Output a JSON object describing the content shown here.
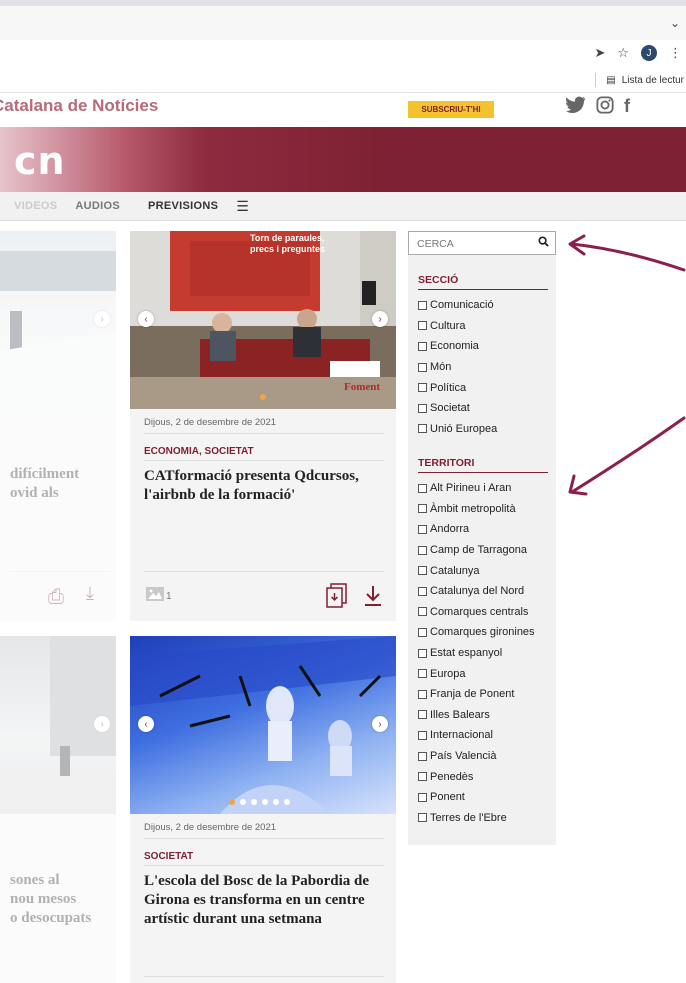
{
  "browser": {
    "avatar_letter": "J",
    "bookmark_label": "Lista de lectur"
  },
  "site": {
    "brand": "Catalana de Notícies",
    "subscribe": "SUBSCRIU-T'HI",
    "logo": "cn",
    "nav": [
      "VIDEOS",
      "AUDIOS",
      "PREVISIONS"
    ],
    "menu_icon": "☰"
  },
  "cards": [
    {
      "date": "Dijous, 2 de desembre de 2021",
      "categories": "ECONOMIA, SOCIETAT",
      "title": "CATformació presenta Qdcursos, l'airbnb de la formació'",
      "photo_count": "1",
      "slide_text": "Torn de paraules, precs i preguntes",
      "slide_brand": "Foment"
    },
    {
      "date": "Dijous, 2 de desembre de 2021",
      "categories": "SOCIETAT",
      "title": "L'escola del Bosc de la Pabordia de Girona es transforma en un centre artístic durant una setmana"
    }
  ],
  "left_cards": [
    {
      "title_lines": [
        "difícilment",
        "ovid als"
      ]
    },
    {
      "title_lines": [
        "sones al",
        "nou mesos",
        "o desocupats"
      ]
    }
  ],
  "sidebar": {
    "search_placeholder": "CERCA",
    "seccio_title": "SECCIÓ",
    "seccio_items": [
      "Comunicació",
      "Cultura",
      "Economia",
      "Món",
      "Política",
      "Societat",
      "Unió Europea"
    ],
    "territori_title": "TERRITORI",
    "territori_items": [
      "Alt Pirineu i Aran",
      "Àmbit metropolità",
      "Andorra",
      "Camp de Tarragona",
      "Catalunya",
      "Catalunya del Nord",
      "Comarques centrals",
      "Comarques gironines",
      "Estat espanyol",
      "Europa",
      "Franja de Ponent",
      "Illes Balears",
      "Internacional",
      "País Valencià",
      "Penedès",
      "Ponent",
      "Terres de l'Ebre"
    ]
  },
  "colors": {
    "brand": "#7f2134",
    "accent": "#f4c22c",
    "annotation_arrow": "#8b1f4d"
  }
}
